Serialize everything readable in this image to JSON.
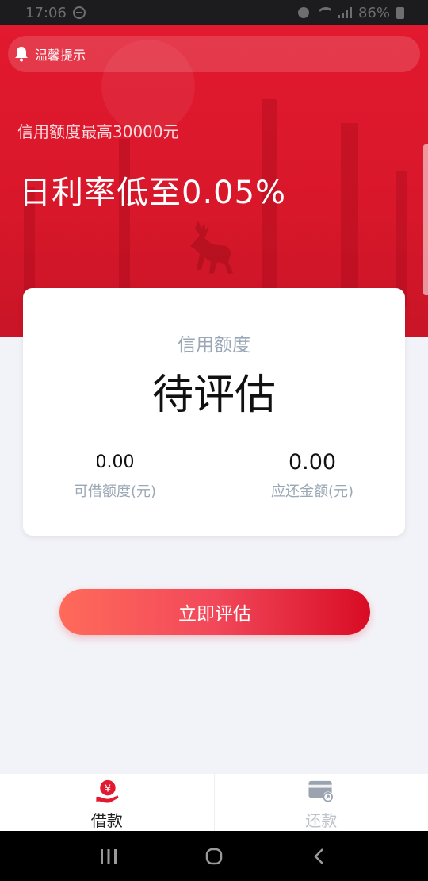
{
  "status_bar": {
    "time": "17:06",
    "battery": "86%"
  },
  "header": {
    "notice_label": "温馨提示",
    "credit_max_text": "信用额度最高30000元",
    "rate_text": "日利率低至0.05%"
  },
  "card": {
    "label": "信用额度",
    "status": "待评估",
    "available_value": "0.00",
    "available_caption": "可借额度(元)",
    "due_value": "0.00",
    "due_caption": "应还金额(元)"
  },
  "cta": {
    "label": "立即评估"
  },
  "tabs": [
    {
      "label": "借款",
      "active": true,
      "icon": "loan-hand-icon"
    },
    {
      "label": "还款",
      "active": false,
      "icon": "repay-card-icon"
    }
  ],
  "colors": {
    "brand_red": "#e2192f",
    "cta_start": "#ff6a5a",
    "cta_end": "#d80c24",
    "muted_text": "#9aa7b5",
    "inactive_tab": "#bfc4cc"
  }
}
